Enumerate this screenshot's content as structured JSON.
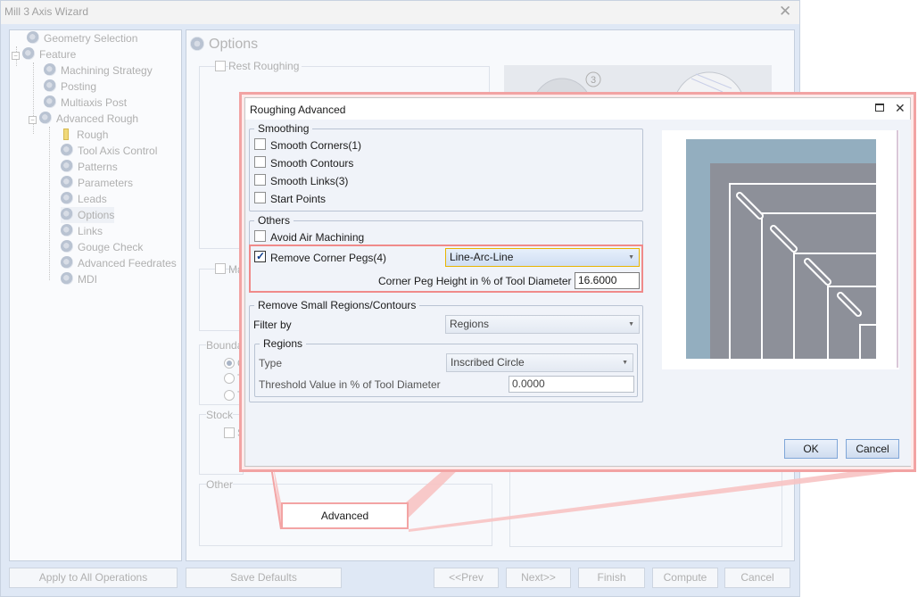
{
  "wizard": {
    "title": "Mill 3 Axis Wizard",
    "tree": [
      {
        "label": "Geometry Selection"
      },
      {
        "label": "Feature"
      },
      {
        "label": "Machining Strategy"
      },
      {
        "label": "Posting"
      },
      {
        "label": "Multiaxis Post"
      },
      {
        "label": "Advanced Rough"
      },
      {
        "label": "Rough"
      },
      {
        "label": "Tool Axis Control"
      },
      {
        "label": "Patterns"
      },
      {
        "label": "Parameters"
      },
      {
        "label": "Leads"
      },
      {
        "label": "Options"
      },
      {
        "label": "Links"
      },
      {
        "label": "Gouge Check"
      },
      {
        "label": "Advanced Feedrates"
      },
      {
        "label": "MDI"
      }
    ],
    "page_title": "Options",
    "rest_roughing_label": "Rest Roughing",
    "ma_label": "Ma",
    "boundary_label": "Boundar",
    "radio_letters": [
      "O",
      "T",
      "T"
    ],
    "stock_label": "Stock",
    "stock_cb_letter": "S",
    "other_label": "Other",
    "preview_number": "3",
    "advanced_button": "Advanced",
    "bottom_buttons": {
      "apply_all": "Apply to All Operations",
      "save_defaults": "Save Defaults",
      "prev": "<<Prev",
      "next": "Next>>",
      "finish": "Finish",
      "compute": "Compute",
      "cancel": "Cancel"
    }
  },
  "dialog": {
    "title": "Roughing Advanced",
    "smoothing": {
      "label": "Smoothing",
      "items": [
        {
          "label": "Smooth Corners(1)",
          "checked": false
        },
        {
          "label": "Smooth Contours",
          "checked": false
        },
        {
          "label": "Smooth Links(3)",
          "checked": false
        },
        {
          "label": "Start Points",
          "checked": false
        }
      ]
    },
    "others": {
      "label": "Others",
      "avoid_air": "Avoid Air Machining",
      "remove_corner_pegs": "Remove Corner Pegs(4)",
      "remove_corner_pegs_checked": true,
      "corner_peg_type": "Line-Arc-Line",
      "corner_peg_height_label": "Corner Peg Height in % of Tool Diameter",
      "corner_peg_height_value": "16.6000"
    },
    "remove_small": {
      "label": "Remove Small Regions/Contours",
      "filter_by_label": "Filter by",
      "filter_by_value": "Regions",
      "regions_label": "Regions",
      "type_label": "Type",
      "type_value": "Inscribed Circle",
      "threshold_label": "Threshold Value in % of Tool Diameter",
      "threshold_value": "0.0000"
    },
    "ok": "OK",
    "cancel": "Cancel"
  },
  "colors": {
    "highlight": "#f08a8a",
    "preview_blue": "#93aebf",
    "preview_gray": "#8d9099",
    "active_combo_border": "#e8b400"
  }
}
